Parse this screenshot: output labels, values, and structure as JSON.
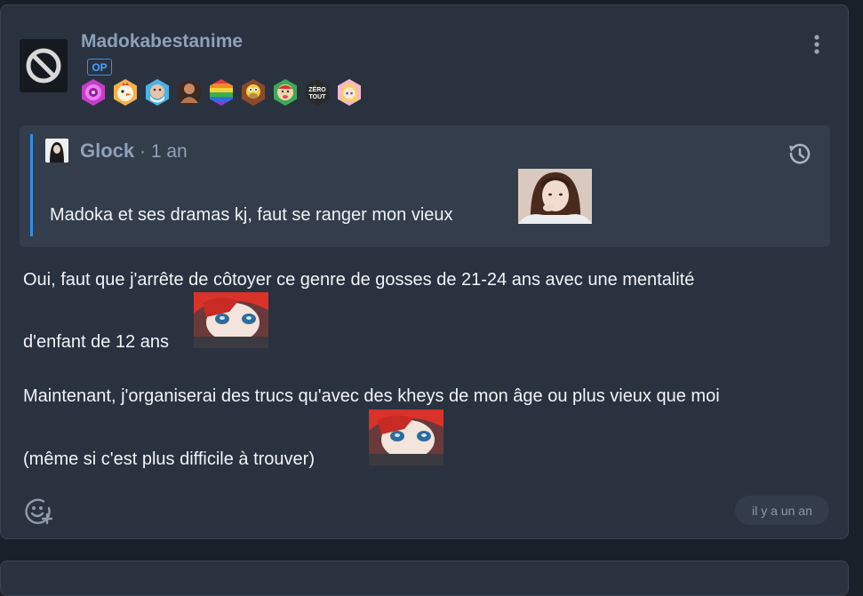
{
  "post": {
    "username": "Madokabestanime",
    "op_label": "OP",
    "avatar_icon": "banned-avatar-icon",
    "badges": [
      {
        "name": "spiral-badge-icon",
        "color": "#d24fd6"
      },
      {
        "name": "chicken-badge-icon",
        "color": "#f1a33a"
      },
      {
        "name": "old-man-badge-icon",
        "color": "#4db5e8"
      },
      {
        "name": "muscle-man-badge-icon",
        "color": "#7a4a35"
      },
      {
        "name": "rainbow-badge-icon",
        "color": "#e6c43a"
      },
      {
        "name": "homer-badge-icon",
        "color": "#d9b23a"
      },
      {
        "name": "tongue-face-badge-icon",
        "color": "#3bb25a"
      },
      {
        "name": "zero-tout-badge-icon",
        "color": "#2b2b2b",
        "text": "ZÉRO TOUT"
      },
      {
        "name": "anime-girl-badge-icon",
        "color": "#f4a3b8"
      }
    ],
    "menu_icon": "kebab-menu-icon"
  },
  "quote": {
    "author": "Glock",
    "separator": " · ",
    "time": "1 an",
    "text": "Madoka et ses dramas kj, faut se ranger mon vieux",
    "history_icon": "history-icon",
    "sticker": "girl-photo-sticker"
  },
  "message": {
    "line1": "Oui, faut que j'arrête de côtoyer ce genre de gosses de 21-24 ans avec une mentalité",
    "line2": "d'enfant de 12 ans",
    "line3": "Maintenant, j'organiserai des trucs qu'avec des kheys de mon âge ou plus vieux que moi",
    "line4": "(même si c'est plus difficile à trouver)",
    "sticker": "red-hair-doll-sticker"
  },
  "footer": {
    "react_icon": "add-reaction-icon",
    "timestamp": "il y a un an"
  }
}
